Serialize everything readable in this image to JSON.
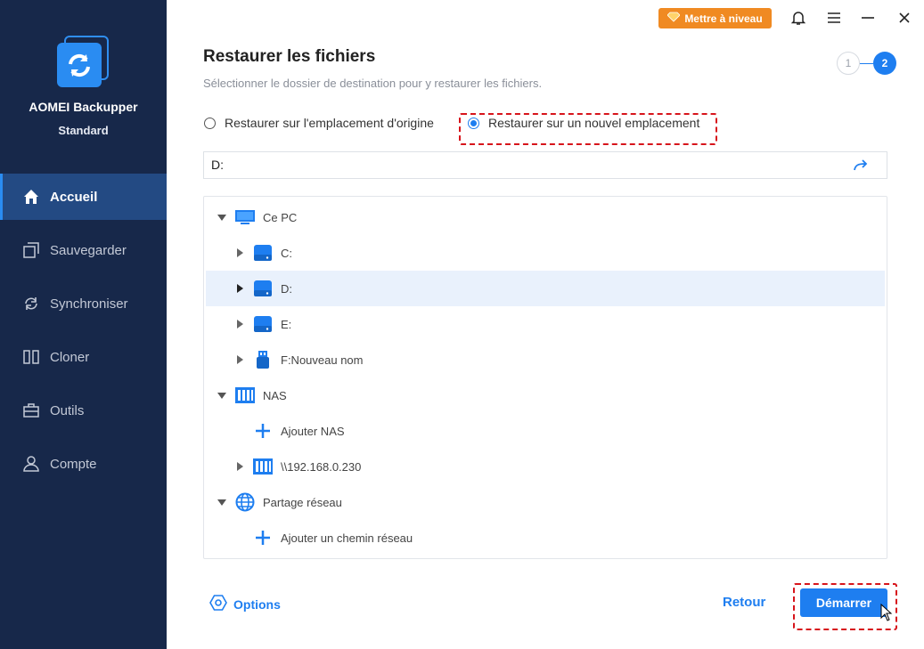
{
  "sidebar": {
    "app_name": "AOMEI Backupper",
    "edition": "Standard",
    "items": [
      {
        "label": "Accueil",
        "icon": "home-icon",
        "active": true
      },
      {
        "label": "Sauvegarder",
        "icon": "backup-icon"
      },
      {
        "label": "Synchroniser",
        "icon": "sync-icon"
      },
      {
        "label": "Cloner",
        "icon": "clone-icon"
      },
      {
        "label": "Outils",
        "icon": "tools-icon"
      },
      {
        "label": "Compte",
        "icon": "user-icon"
      }
    ]
  },
  "topbar": {
    "upgrade_label": "Mettre à niveau"
  },
  "main": {
    "title": "Restaurer les fichiers",
    "subtitle": "Sélectionner le dossier de destination pour y restaurer les fichiers.",
    "steps": [
      "1",
      "2"
    ],
    "current_step": 2,
    "options": {
      "original": "Restaurer sur l'emplacement d'origine",
      "new": "Restaurer sur un nouvel emplacement",
      "selected": "new"
    },
    "path_value": "D:",
    "tree": [
      {
        "label": "Ce PC",
        "icon": "computer-icon",
        "level": 0,
        "expanded": true
      },
      {
        "label": "C:",
        "icon": "drive-icon",
        "level": 1
      },
      {
        "label": "D:",
        "icon": "drive-icon",
        "level": 1,
        "selected": true
      },
      {
        "label": "E:",
        "icon": "drive-icon",
        "level": 1
      },
      {
        "label": "F:Nouveau nom",
        "icon": "usb-drive-icon",
        "level": 1
      },
      {
        "label": "NAS",
        "icon": "nas-icon",
        "level": 0,
        "expanded": true
      },
      {
        "label": "Ajouter NAS",
        "icon": "plus-icon",
        "level": 1
      },
      {
        "label": "\\\\192.168.0.230",
        "icon": "nas-icon",
        "level": 1
      },
      {
        "label": "Partage réseau",
        "icon": "globe-icon",
        "level": 0,
        "expanded": true
      },
      {
        "label": "Ajouter un chemin réseau",
        "icon": "plus-icon",
        "level": 1
      }
    ],
    "options_label": "Options",
    "back_label": "Retour",
    "start_label": "Démarrer"
  },
  "colors": {
    "sidebar_bg": "#17284a",
    "active_nav": "#234a83",
    "accent": "#1e7ef0",
    "upgrade": "#f08a22",
    "highlight": "#d7141b"
  }
}
